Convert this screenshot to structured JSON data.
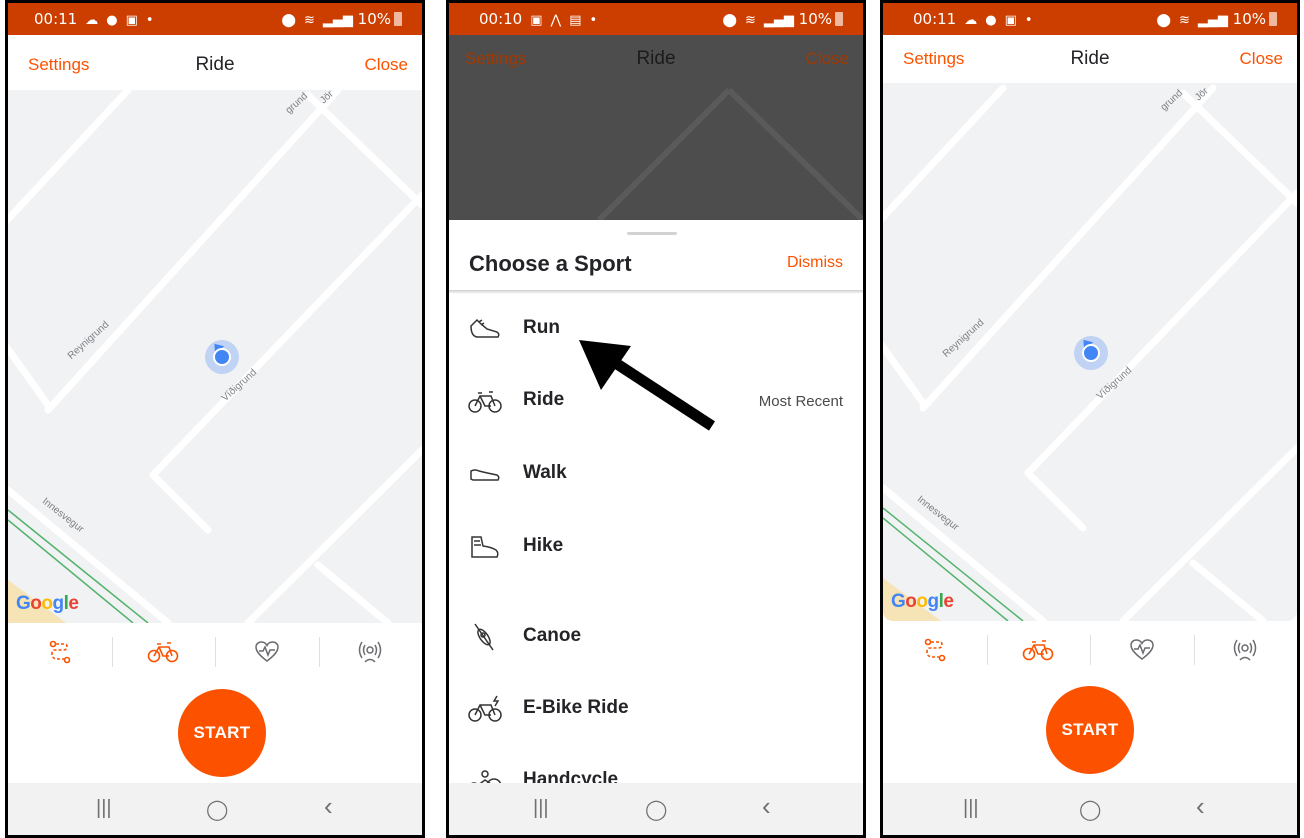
{
  "screens": [
    {
      "status": {
        "time": "00:11",
        "battery": "10%"
      },
      "header": {
        "left": "Settings",
        "title": "Ride",
        "right": "Close"
      },
      "map": {
        "streets": [
          "Reynigrund",
          "Víðigrund",
          "Innesvegur",
          "grund",
          "Jör"
        ],
        "attribution": {
          "letters": [
            "G",
            "o",
            "o",
            "g",
            "l",
            "e"
          ],
          "colors": [
            "#4285f4",
            "#ea4335",
            "#fbbc05",
            "#4285f4",
            "#34a853",
            "#ea4335"
          ]
        }
      },
      "tabs": [
        {
          "icon": "route-icon",
          "active": true
        },
        {
          "icon": "bike-icon",
          "active": true
        },
        {
          "icon": "heart-rate-icon",
          "active": false
        },
        {
          "icon": "sensor-icon",
          "active": false
        }
      ],
      "start_label": "START"
    },
    {
      "status": {
        "time": "00:10",
        "battery": "10%"
      },
      "header": {
        "left": "Settings",
        "title": "Ride",
        "right": "Close"
      },
      "sheet": {
        "title": "Choose a Sport",
        "dismiss": "Dismiss",
        "items": [
          {
            "label": "Run",
            "icon": "run-shoe-icon",
            "tag": ""
          },
          {
            "label": "Ride",
            "icon": "bike-icon",
            "tag": "Most Recent"
          },
          {
            "label": "Walk",
            "icon": "walk-shoe-icon",
            "tag": ""
          },
          {
            "label": "Hike",
            "icon": "hike-boot-icon",
            "tag": ""
          },
          {
            "label": "Canoe",
            "icon": "canoe-icon",
            "tag": ""
          },
          {
            "label": "E-Bike Ride",
            "icon": "ebike-icon",
            "tag": ""
          },
          {
            "label": "Handcycle",
            "icon": "handcycle-icon",
            "tag": ""
          }
        ]
      }
    },
    {
      "status": {
        "time": "00:11",
        "battery": "10%"
      },
      "header": {
        "left": "Settings",
        "title": "Ride",
        "right": "Close"
      },
      "map": {
        "streets": [
          "Reynigrund",
          "Víðigrund",
          "Innesvegur",
          "grund",
          "Jör"
        ],
        "attribution": {
          "letters": [
            "G",
            "o",
            "o",
            "g",
            "l",
            "e"
          ],
          "colors": [
            "#4285f4",
            "#ea4335",
            "#fbbc05",
            "#4285f4",
            "#34a853",
            "#ea4335"
          ]
        }
      },
      "tabs": [
        {
          "icon": "route-icon",
          "active": true
        },
        {
          "icon": "bike-icon",
          "active": true
        },
        {
          "icon": "heart-rate-icon",
          "active": false
        },
        {
          "icon": "sensor-icon",
          "active": false
        }
      ],
      "start_label": "START"
    }
  ],
  "navbar": {
    "recents": "|||",
    "home": "◯",
    "back": "‹"
  },
  "colors": {
    "accent": "#fc5200",
    "statusbar": "#cc3e00",
    "map_bg": "#f1f2f4",
    "location": "#4285f4"
  }
}
